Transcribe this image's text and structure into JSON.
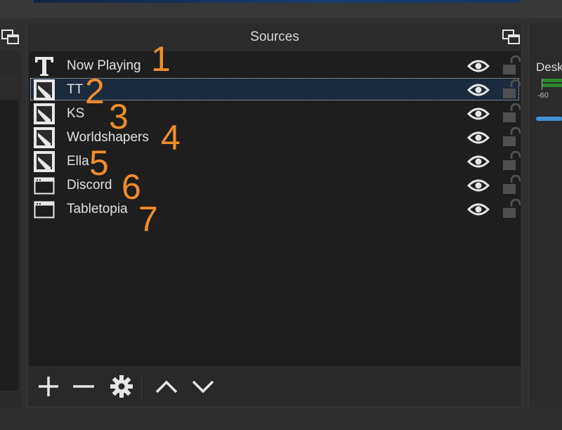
{
  "sources_dock": {
    "title": "Sources",
    "items": [
      {
        "name": "Now Playing",
        "type": "text-source-icon",
        "annotation": "1"
      },
      {
        "name": "TT",
        "type": "image-source-icon",
        "annotation": "2"
      },
      {
        "name": "KS",
        "type": "image-source-icon",
        "annotation": "3"
      },
      {
        "name": "Worldshapers",
        "type": "image-source-icon",
        "annotation": "4"
      },
      {
        "name": "Ella",
        "type": "image-source-icon",
        "annotation": "5"
      },
      {
        "name": "Discord",
        "type": "window-capture-icon",
        "annotation": "6"
      },
      {
        "name": "Tabletopia",
        "type": "window-capture-icon",
        "annotation": "7"
      }
    ],
    "selected_index": 1,
    "toolbar": [
      "add-icon",
      "remove-icon",
      "gear-icon",
      "move-up-icon",
      "move-down-icon"
    ]
  },
  "audio_mixer": {
    "label": "Desk",
    "scale_label": "-60"
  },
  "colors": {
    "annotation": "#f28c28",
    "selection": "#1b2a3c",
    "list_background": "#1e1e1e",
    "panel_background": "#2b2b2b"
  }
}
